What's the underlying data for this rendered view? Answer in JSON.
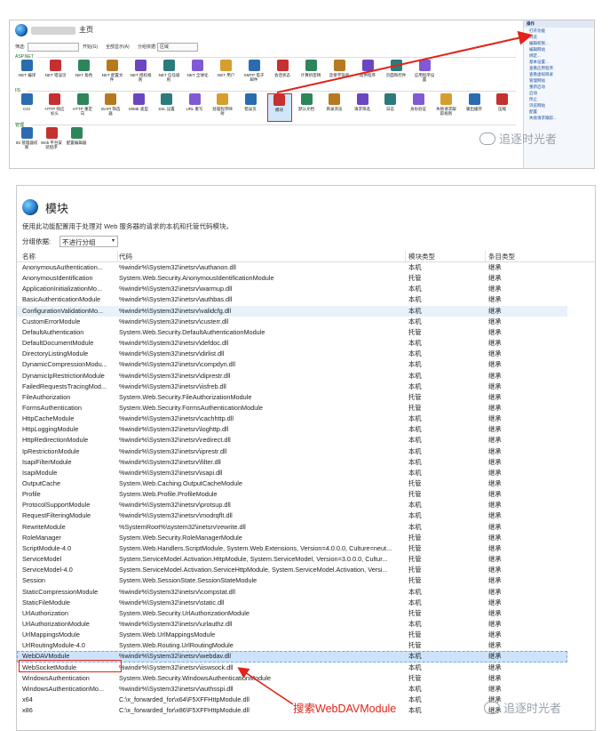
{
  "top_window": {
    "title": "主页",
    "toolbar": {
      "filter_label": "筛选:",
      "start_label": "开始(G)",
      "show_all_label": "全部显示(A)",
      "group_label": "分组依据:",
      "group_value": "区域"
    },
    "sections": {
      "aspnet": "ASP.NET",
      "iis": "IIS",
      "management": "管理"
    },
    "aspnet_tiles": [
      ".NET 编译",
      ".NET 错误页",
      ".NET 角色",
      ".NET 配置文件",
      ".NET 授权规则",
      ".NET 信任级别",
      ".NET 全球化",
      ".NET 用户",
      "SMTP 电子邮件",
      "会话状态",
      "计算机密钥",
      "连接字符串",
      "提供程序",
      "页面和控件",
      "应用程序设置"
    ],
    "iis_tiles": [
      "CGI",
      "HTTP 响应标头",
      "HTTP 重定向",
      "ISAPI 筛选器",
      "MIME 类型",
      "SSL 设置",
      "URL 重写",
      "处理程序映射",
      "错误页",
      "模块",
      "默认文档",
      "目录浏览",
      "请求筛选",
      "日志",
      "身份验证",
      "失败请求跟踪规则",
      "输出缓存",
      "压缩"
    ],
    "mgmt_tiles": [
      "IIS 管理器权限",
      "Web 平台安装程序",
      "配置编辑器"
    ],
    "actions": {
      "header": "操作",
      "items": [
        "打开功能",
        "浏览",
        "编辑权限...",
        "编辑网站",
        "绑定...",
        "基本设置...",
        "查看应用程序",
        "查看虚拟目录",
        "管理网站",
        "重新启动",
        "启动",
        "停止",
        "浏览网站",
        "配置",
        "失败请求跟踪..."
      ]
    }
  },
  "watermark": {
    "text": "追逐时光者"
  },
  "modules_page": {
    "title": "模块",
    "description": "使用此功能配置用于处理对 Web 服务器的请求的本机和托管代码模块。",
    "group_by_label": "分组依据:",
    "group_by_value": "不进行分组",
    "columns": [
      "名称",
      "代码",
      "模块类型",
      "条目类型"
    ],
    "rows": [
      [
        "AnonymousAuthentication...",
        "%windir%\\System32\\inetsrv\\authanon.dll",
        "本机",
        "继承"
      ],
      [
        "AnonymousIdentification",
        "System.Web.Security.AnonymousIdentificationModule",
        "托管",
        "继承"
      ],
      [
        "ApplicationInitializationMo...",
        "%windir%\\System32\\inetsrv\\warmup.dll",
        "本机",
        "继承"
      ],
      [
        "BasicAuthenticationModule",
        "%windir%\\System32\\inetsrv\\authbas.dll",
        "本机",
        "继承"
      ],
      [
        "ConfigurationValidationMo...",
        "%windir%\\System32\\inetsrv\\validcfg.dll",
        "本机",
        "继承"
      ],
      [
        "CustomErrorModule",
        "%windir%\\System32\\inetsrv\\custerr.dll",
        "本机",
        "继承"
      ],
      [
        "DefaultAuthentication",
        "System.Web.Security.DefaultAuthenticationModule",
        "托管",
        "继承"
      ],
      [
        "DefaultDocumentModule",
        "%windir%\\System32\\inetsrv\\defdoc.dll",
        "本机",
        "继承"
      ],
      [
        "DirectoryListingModule",
        "%windir%\\System32\\inetsrv\\dirlist.dll",
        "本机",
        "继承"
      ],
      [
        "DynamicCompressionModu...",
        "%windir%\\System32\\inetsrv\\compdyn.dll",
        "本机",
        "继承"
      ],
      [
        "DynamicIpRestrictionModule",
        "%windir%\\System32\\inetsrv\\diprestr.dll",
        "本机",
        "继承"
      ],
      [
        "FailedRequestsTracingMod...",
        "%windir%\\System32\\inetsrv\\iisfreb.dll",
        "本机",
        "继承"
      ],
      [
        "FileAuthorization",
        "System.Web.Security.FileAuthorizationModule",
        "托管",
        "继承"
      ],
      [
        "FormsAuthentication",
        "System.Web.Security.FormsAuthenticationModule",
        "托管",
        "继承"
      ],
      [
        "HttpCacheModule",
        "%windir%\\System32\\inetsrv\\cachhttp.dll",
        "本机",
        "继承"
      ],
      [
        "HttpLoggingModule",
        "%windir%\\System32\\inetsrv\\loghttp.dll",
        "本机",
        "继承"
      ],
      [
        "HttpRedirectionModule",
        "%windir%\\System32\\inetsrv\\redirect.dll",
        "本机",
        "继承"
      ],
      [
        "IpRestrictionModule",
        "%windir%\\System32\\inetsrv\\iprestr.dll",
        "本机",
        "继承"
      ],
      [
        "IsapiFilterModule",
        "%windir%\\System32\\inetsrv\\filter.dll",
        "本机",
        "继承"
      ],
      [
        "IsapiModule",
        "%windir%\\System32\\inetsrv\\isapi.dll",
        "本机",
        "继承"
      ],
      [
        "OutputCache",
        "System.Web.Caching.OutputCacheModule",
        "托管",
        "继承"
      ],
      [
        "Profile",
        "System.Web.Profile.ProfileModule",
        "托管",
        "继承"
      ],
      [
        "ProtocolSupportModule",
        "%windir%\\System32\\inetsrv\\protsup.dll",
        "本机",
        "继承"
      ],
      [
        "RequestFilteringModule",
        "%windir%\\System32\\inetsrv\\modrqflt.dll",
        "本机",
        "继承"
      ],
      [
        "RewriteModule",
        "%SystemRoot%\\system32\\inetsrv\\rewrite.dll",
        "本机",
        "继承"
      ],
      [
        "RoleManager",
        "System.Web.Security.RoleManagerModule",
        "托管",
        "继承"
      ],
      [
        "ScriptModule-4.0",
        "System.Web.Handlers.ScriptModule, System.Web.Extensions, Version=4.0.0.0, Culture=neut...",
        "托管",
        "继承"
      ],
      [
        "ServiceModel",
        "System.ServiceModel.Activation.HttpModule, System.ServiceModel, Version=3.0.0.0, Cultur...",
        "托管",
        "继承"
      ],
      [
        "ServiceModel-4.0",
        "System.ServiceModel.Activation.ServiceHttpModule, System.ServiceModel.Activation, Versi...",
        "托管",
        "继承"
      ],
      [
        "Session",
        "System.Web.SessionState.SessionStateModule",
        "托管",
        "继承"
      ],
      [
        "StaticCompressionModule",
        "%windir%\\System32\\inetsrv\\compstat.dll",
        "本机",
        "继承"
      ],
      [
        "StaticFileModule",
        "%windir%\\System32\\inetsrv\\static.dll",
        "本机",
        "继承"
      ],
      [
        "UrlAuthorization",
        "System.Web.Security.UrlAuthorizationModule",
        "托管",
        "继承"
      ],
      [
        "UrlAuthorizationModule",
        "%windir%\\System32\\inetsrv\\urlauthz.dll",
        "本机",
        "继承"
      ],
      [
        "UrlMappingsModule",
        "System.Web.UrlMappingsModule",
        "托管",
        "继承"
      ],
      [
        "UrlRoutingModule-4.0",
        "System.Web.Routing.UrlRoutingModule",
        "托管",
        "继承"
      ],
      [
        "WebDAVModule",
        "%windir%\\System32\\inetsrv\\webdav.dll",
        "本机",
        "继承"
      ],
      [
        "WebSocketModule",
        "%windir%\\System32\\inetsrv\\iiswsock.dll",
        "本机",
        "继承"
      ],
      [
        "WindowsAuthentication",
        "System.Web.Security.WindowsAuthenticationModule",
        "托管",
        "继承"
      ],
      [
        "WindowsAuthenticationMo...",
        "%windir%\\System32\\inetsrv\\authsspi.dll",
        "本机",
        "继承"
      ],
      [
        "x64",
        "C:\\x_forwarded_for\\x64\\F5XFFHttpModule.dll",
        "本机",
        "继承"
      ],
      [
        "x86",
        "C:\\x_forwarded_for\\x86\\F5XFFHttpModule.dll",
        "本机",
        "继承"
      ]
    ],
    "selected_row": "WebDAVModule"
  },
  "annotation": {
    "search_text": "搜索WebDAVModule",
    "color": "#e2231a"
  }
}
